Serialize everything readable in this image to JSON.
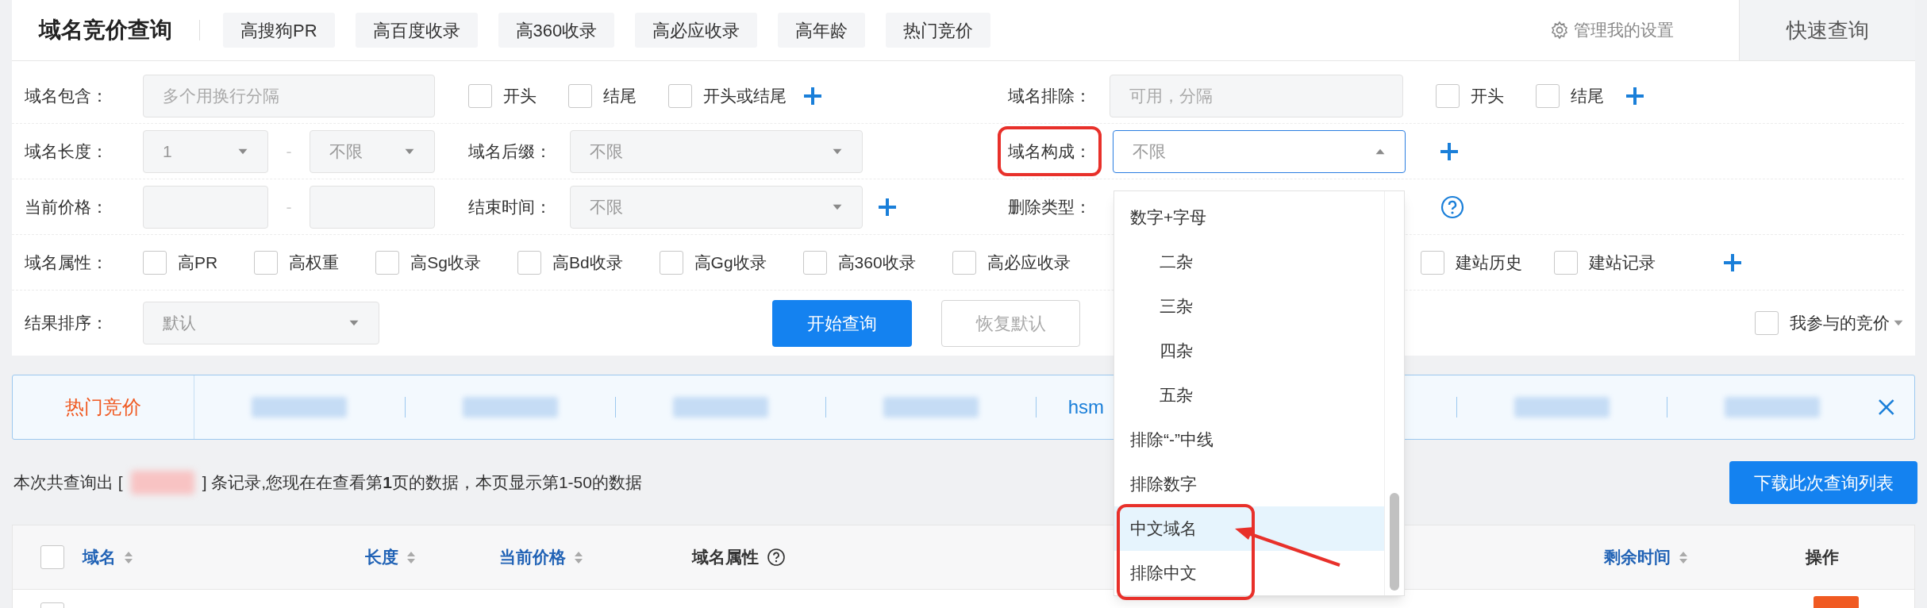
{
  "header": {
    "title": "域名竞价查询",
    "tabs": [
      "高搜狗PR",
      "高百度收录",
      "高360收录",
      "高必应收录",
      "高年龄",
      "热门竞价"
    ],
    "settings_link": "管理我的设置",
    "quick_query": "快速查询"
  },
  "filters": {
    "contains": {
      "label": "域名包含：",
      "placeholder": "多个用换行分隔",
      "options": [
        {
          "label": "开头",
          "checked": false
        },
        {
          "label": "结尾",
          "checked": false
        },
        {
          "label": "开头或结尾",
          "checked": false
        }
      ]
    },
    "exclude": {
      "label": "域名排除：",
      "placeholder": "可用，分隔",
      "options": [
        {
          "label": "开头",
          "checked": false
        },
        {
          "label": "结尾",
          "checked": false
        }
      ]
    },
    "length": {
      "label": "域名长度：",
      "min": "1",
      "separator": "-",
      "max": "不限"
    },
    "suffix": {
      "label": "域名后缀：",
      "value": "不限"
    },
    "composition": {
      "label": "域名构成：",
      "value": "不限",
      "expanded": true,
      "annotated": true
    },
    "price": {
      "label": "当前价格：",
      "separator": "-"
    },
    "end_time": {
      "label": "结束时间：",
      "value": "不限"
    },
    "delete_type": {
      "label": "删除类型："
    },
    "attributes": {
      "label": "域名属性：",
      "options": [
        {
          "label": "高PR",
          "checked": false
        },
        {
          "label": "高权重",
          "checked": false
        },
        {
          "label": "高Sg收录",
          "checked": false
        },
        {
          "label": "高Bd收录",
          "checked": false
        },
        {
          "label": "高Gg收录",
          "checked": false
        },
        {
          "label": "高360收录",
          "checked": false
        },
        {
          "label": "高必应收录",
          "checked": false
        }
      ],
      "more_options": [
        {
          "label": "建站历史",
          "checked": false
        },
        {
          "label": "建站记录",
          "checked": false
        }
      ]
    },
    "sort": {
      "label": "结果排序：",
      "value": "默认"
    }
  },
  "buttons": {
    "search": "开始查询",
    "reset": "恢复默认"
  },
  "my_bids": {
    "label": "我参与的竞价",
    "checked": false
  },
  "composition_options": [
    {
      "label": "数字+字母",
      "highlighted": false,
      "annotated": false,
      "children": [
        {
          "label": "二杂",
          "highlighted": false,
          "annotated": false
        },
        {
          "label": "三杂",
          "highlighted": false,
          "annotated": false
        },
        {
          "label": "四杂",
          "highlighted": false,
          "annotated": false
        },
        {
          "label": "五杂",
          "highlighted": false,
          "annotated": false
        }
      ]
    },
    {
      "label": "排除“-”中线",
      "highlighted": false,
      "annotated": false
    },
    {
      "label": "排除数字",
      "highlighted": false,
      "annotated": false
    },
    {
      "label": "中文域名",
      "highlighted": true,
      "annotated": true
    },
    {
      "label": "排除中文",
      "highlighted": false,
      "annotated": true
    }
  ],
  "hot_bids": {
    "label": "热门竞价",
    "items": [
      {
        "kind": "redacted"
      },
      {
        "kind": "redacted"
      },
      {
        "kind": "redacted"
      },
      {
        "kind": "redacted"
      },
      {
        "kind": "text",
        "text": "hsm"
      },
      {
        "kind": "redacted"
      },
      {
        "kind": "redacted"
      }
    ]
  },
  "summary": {
    "prefix": "本次共查询出 [",
    "suffix": "] 条记录,您现在在查看第**1**页的数据，本页显示第1-50的数据"
  },
  "download_button": "下载此次查询列表",
  "table": {
    "header_checkbox": {
      "checked": false
    },
    "row_checkbox": {
      "checked": false
    },
    "columns": [
      {
        "label": "域名",
        "sortable": true,
        "help": false
      },
      {
        "label": "长度",
        "sortable": true,
        "help": false
      },
      {
        "label": "当前价格",
        "sortable": true,
        "help": false
      },
      {
        "label": "域名属性",
        "sortable": false,
        "help": true
      },
      {
        "label": "剩余时间",
        "sortable": true,
        "help": false
      },
      {
        "label": "操作",
        "sortable": false,
        "help": false
      }
    ]
  }
}
